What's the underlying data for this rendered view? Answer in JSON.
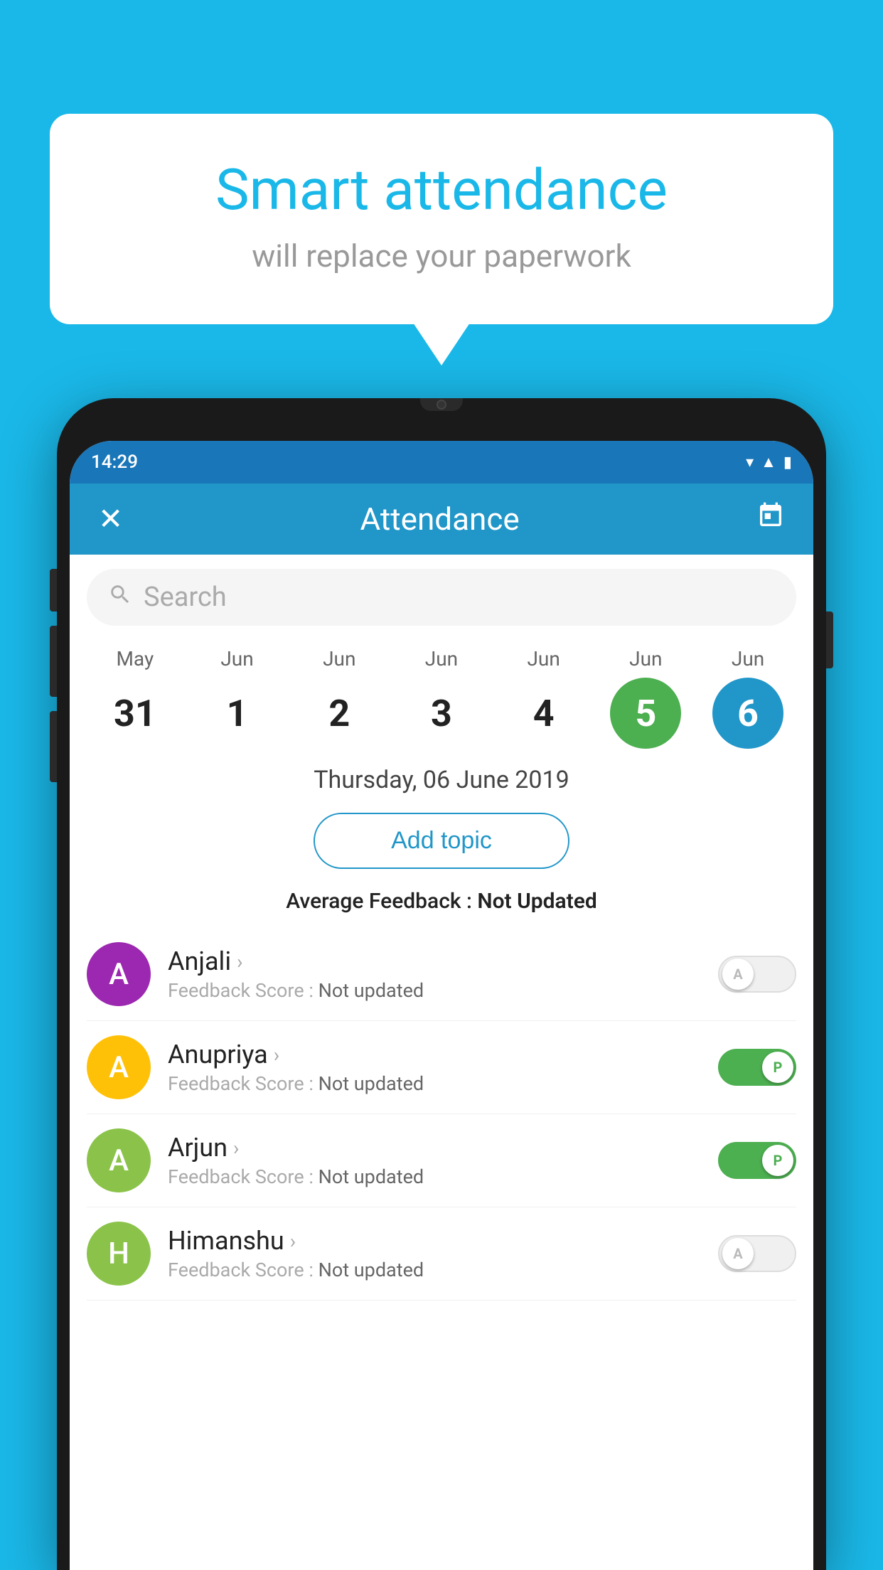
{
  "bubble": {
    "title": "Smart attendance",
    "subtitle": "will replace your paperwork"
  },
  "statusBar": {
    "time": "14:29",
    "icons": [
      "wifi",
      "signal",
      "battery"
    ]
  },
  "header": {
    "title": "Attendance",
    "closeLabel": "✕",
    "calendarLabel": "📅"
  },
  "search": {
    "placeholder": "Search"
  },
  "calendar": {
    "days": [
      {
        "month": "May",
        "date": "31",
        "state": "normal"
      },
      {
        "month": "Jun",
        "date": "1",
        "state": "normal"
      },
      {
        "month": "Jun",
        "date": "2",
        "state": "normal"
      },
      {
        "month": "Jun",
        "date": "3",
        "state": "normal"
      },
      {
        "month": "Jun",
        "date": "4",
        "state": "normal"
      },
      {
        "month": "Jun",
        "date": "5",
        "state": "today"
      },
      {
        "month": "Jun",
        "date": "6",
        "state": "selected"
      }
    ]
  },
  "selectedDate": "Thursday, 06 June 2019",
  "addTopicLabel": "Add topic",
  "avgFeedback": {
    "label": "Average Feedback : ",
    "value": "Not Updated"
  },
  "students": [
    {
      "name": "Anjali",
      "avatarLetter": "A",
      "avatarColor": "#9c27b0",
      "feedback": "Not updated",
      "toggleState": "off",
      "toggleLabel": "A"
    },
    {
      "name": "Anupriya",
      "avatarLetter": "A",
      "avatarColor": "#ffc107",
      "feedback": "Not updated",
      "toggleState": "on",
      "toggleLabel": "P"
    },
    {
      "name": "Arjun",
      "avatarLetter": "A",
      "avatarColor": "#8bc34a",
      "feedback": "Not updated",
      "toggleState": "on",
      "toggleLabel": "P"
    },
    {
      "name": "Himanshu",
      "avatarLetter": "H",
      "avatarColor": "#8bc34a",
      "feedback": "Not updated",
      "toggleState": "off",
      "toggleLabel": "A"
    }
  ],
  "feedbackScoreLabel": "Feedback Score : "
}
